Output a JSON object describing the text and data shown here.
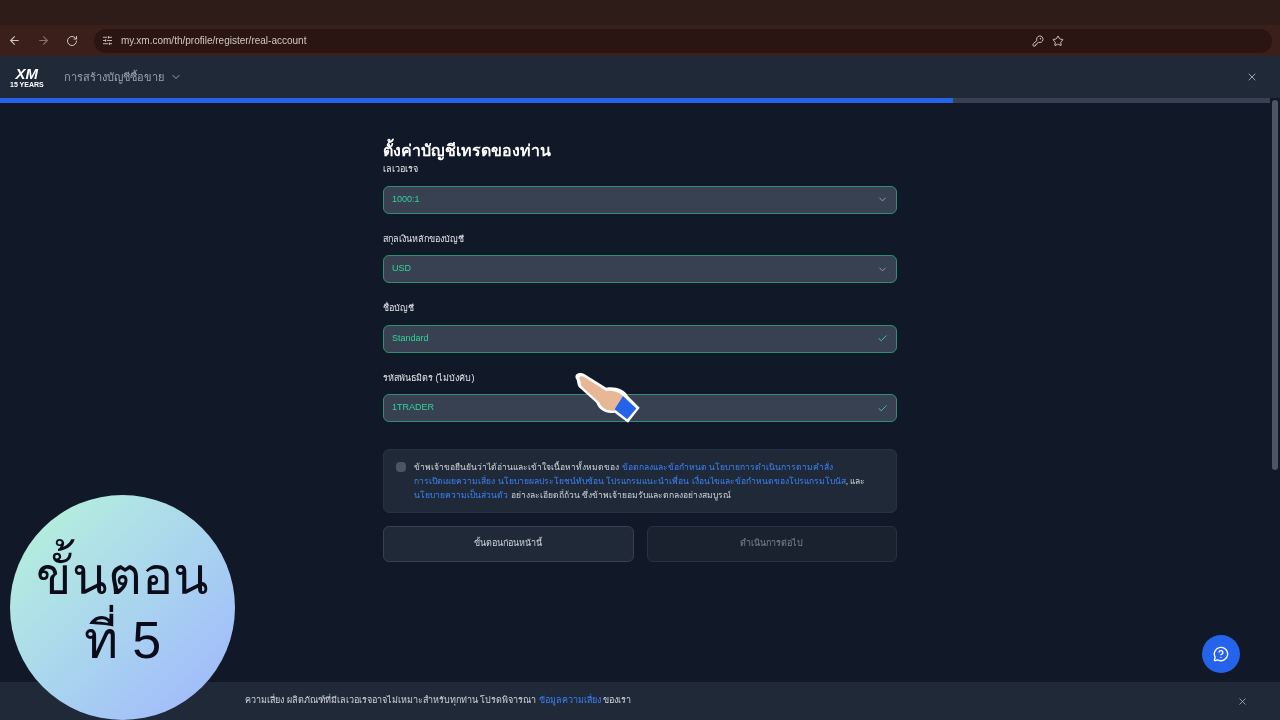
{
  "browser": {
    "url": "my.xm.com/th/profile/register/real-account"
  },
  "header": {
    "logo": "XM",
    "logo_sub": "15 YEARS",
    "menu": "การสร้างบัญชีซื้อขาย"
  },
  "progress": {
    "level": 0.75
  },
  "form": {
    "title": "ตั้งค่าบัญชีเทรดของท่าน",
    "fields": [
      {
        "label": "เลเวอเรจ",
        "value": "1000:1",
        "kind": "select"
      },
      {
        "label": "สกุลเงินหลักของบัญชี",
        "value": "USD",
        "kind": "select"
      },
      {
        "label": "ชื่อบัญชี",
        "value": "Standard",
        "kind": "valid"
      },
      {
        "label": "รหัสพันธมิตร (ไม่บังคับ)",
        "value": "1TRADER",
        "kind": "valid"
      }
    ],
    "consent": {
      "checked": false,
      "segments": [
        {
          "text": "ข้าพเจ้าขอยืนยันว่าได้อ่านและเข้าใจเนื้อหาทั้งหมดของ",
          "kind": "text"
        },
        {
          "text": "ข้อตกลงและข้อกำหนด",
          "kind": "link"
        },
        {
          "text": "นโยบายการดำเนินการตามคำสั่ง",
          "kind": "link"
        },
        {
          "text": "การเปิดเผยความเสี่ยง",
          "kind": "link"
        },
        {
          "text": "นโยบายผลประโยชน์ทับซ้อน",
          "kind": "link"
        },
        {
          "text": "โปรแกรมแนะนำเพื่อน",
          "kind": "link"
        },
        {
          "text": "เงื่อนไขและข้อกำหนดของโปรแกรมโบนัส",
          "kind": "link"
        },
        {
          "text": ", และ",
          "kind": "text"
        },
        {
          "text": "นโยบายความเป็นส่วนตัว",
          "kind": "link"
        },
        {
          "text": "อย่างละเอียดถี่ถ้วน ซึ่งข้าพเจ้ายอมรับและตกลงอย่างสมบูรณ์",
          "kind": "text"
        }
      ]
    },
    "buttons": [
      {
        "label": "ขั้นตอนก่อนหน้านี้",
        "disabled": false
      },
      {
        "label": "ดำเนินการต่อไป",
        "disabled": true
      }
    ]
  },
  "footer": {
    "segments": [
      {
        "text": "ความเสี่ยง ผลิตภัณฑ์ที่มีเลเวอเรจอาจไม่เหมาะสำหรับทุกท่าน โปรดพิจารณา",
        "kind": "text"
      },
      {
        "text": "ข้อมูลความเสี่ยง",
        "kind": "link"
      },
      {
        "text": "ของเรา",
        "kind": "text"
      }
    ]
  },
  "step_badge": {
    "line1": "ขั้นตอน",
    "line2": "ที่ 5"
  }
}
